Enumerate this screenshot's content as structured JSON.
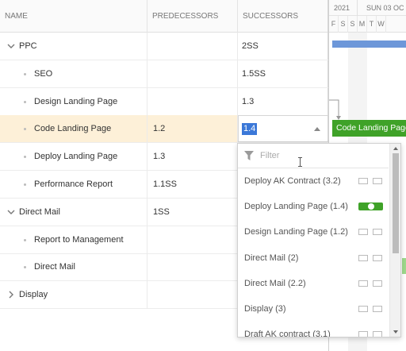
{
  "columns": {
    "name": "NAME",
    "predecessors": "PREDECESSORS",
    "successors": "SUCCESSORS"
  },
  "rows": [
    {
      "name": "PPC",
      "pred": "",
      "succ": "2SS",
      "level": 0,
      "expander": "chevron-down-icon"
    },
    {
      "name": "SEO",
      "pred": "",
      "succ": "1.5SS",
      "level": 1
    },
    {
      "name": "Design Landing Page",
      "pred": "",
      "succ": "1.3",
      "level": 1
    },
    {
      "name": "Code Landing Page",
      "pred": "1.2",
      "succ": "",
      "level": 1,
      "selected": true
    },
    {
      "name": "Deploy Landing Page",
      "pred": "1.3",
      "succ": "",
      "level": 1
    },
    {
      "name": "Performance Report",
      "pred": "1.1SS",
      "succ": "",
      "level": 1
    },
    {
      "name": "Direct Mail",
      "pred": "1SS",
      "succ": "",
      "level": 0,
      "expander": "chevron-down-icon"
    },
    {
      "name": "Report to Management",
      "pred": "",
      "succ": "",
      "level": 1
    },
    {
      "name": "Direct Mail",
      "pred": "",
      "succ": "",
      "level": 1
    },
    {
      "name": "Display",
      "pred": "",
      "succ": "",
      "level": 0,
      "expander": "chevron-right-icon"
    }
  ],
  "timeline": {
    "year": "2021",
    "week": "SUN 03 OC",
    "days": [
      "F",
      "S",
      "S",
      "M",
      "T",
      "W"
    ],
    "bar_label": "Code Landing Page"
  },
  "editor": {
    "value": "1.4"
  },
  "dropdown": {
    "filter_placeholder": "Filter",
    "options": [
      {
        "label": "Deploy AK Contract (3.2)",
        "on": false
      },
      {
        "label": "Deploy Landing Page (1.4)",
        "on": true
      },
      {
        "label": "Design Landing Page (1.2)",
        "on": false
      },
      {
        "label": "Direct Mail (2)",
        "on": false
      },
      {
        "label": "Direct Mail (2.2)",
        "on": false
      },
      {
        "label": "Display (3)",
        "on": false
      },
      {
        "label": "Draft AK contract (3.1)",
        "on": false
      }
    ]
  },
  "colors": {
    "accent_green": "#3fa228",
    "bar_blue": "#6d97d9",
    "selection": "#3b78d8",
    "selected_row": "#fdf0d8"
  }
}
